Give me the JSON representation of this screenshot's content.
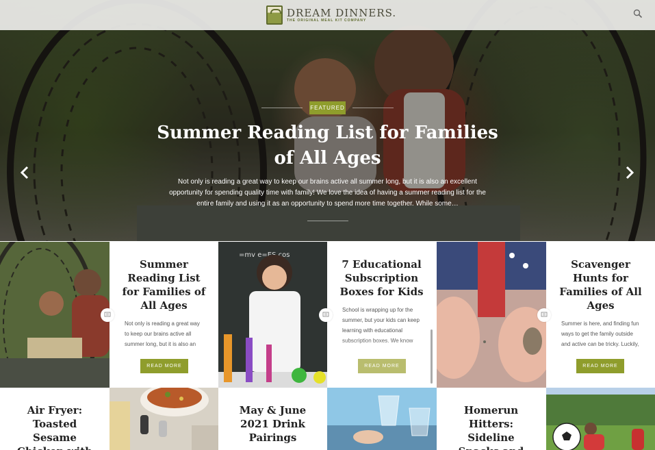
{
  "header": {
    "logo_title": "DREAM DINNERS.",
    "logo_subtitle": "THE ORIGINAL MEAL KIT COMPANY",
    "search_icon": "search-icon"
  },
  "hero": {
    "badge": "FEATURED",
    "title": "Summer Reading List for Families of All Ages",
    "excerpt": "Not only is reading a great way to keep our brains active all summer long, but it is also an excellent opportunity for spending quality time with family! We love the idea of having a summer reading list for the entire family and using it as an opportunity to spend more time together. While some…",
    "prev_icon": "chevron-left-icon",
    "next_icon": "chevron-right-icon"
  },
  "posts": [
    {
      "title": "Summer Reading List for Families of All Ages",
      "excerpt": "Not only is reading a great way to keep our brains active all summer long, but it is also an",
      "read_more": "READ MORE"
    },
    {
      "title": "7 Educational Subscription Boxes for Kids",
      "excerpt": "School is wrapping up for the summer, but your kids can keep learning with educational subscription boxes. We know how tricky it can be to keep the",
      "read_more": "READ MORE"
    },
    {
      "title": "Scavenger Hunts for Families of All Ages",
      "excerpt": "Summer is here, and finding fun ways to get the family outside and active can be tricky. Luckily,",
      "read_more": "READ MORE"
    },
    {
      "title": "Air Fryer: Toasted Sesame Chicken with"
    },
    {
      "title": "May & June 2021 Drink Pairings"
    },
    {
      "title": "Homerun Hitters: Sideline Snacks and"
    }
  ],
  "colors": {
    "accent": "#8f9d2c",
    "header_bg": "#eeeeec"
  }
}
